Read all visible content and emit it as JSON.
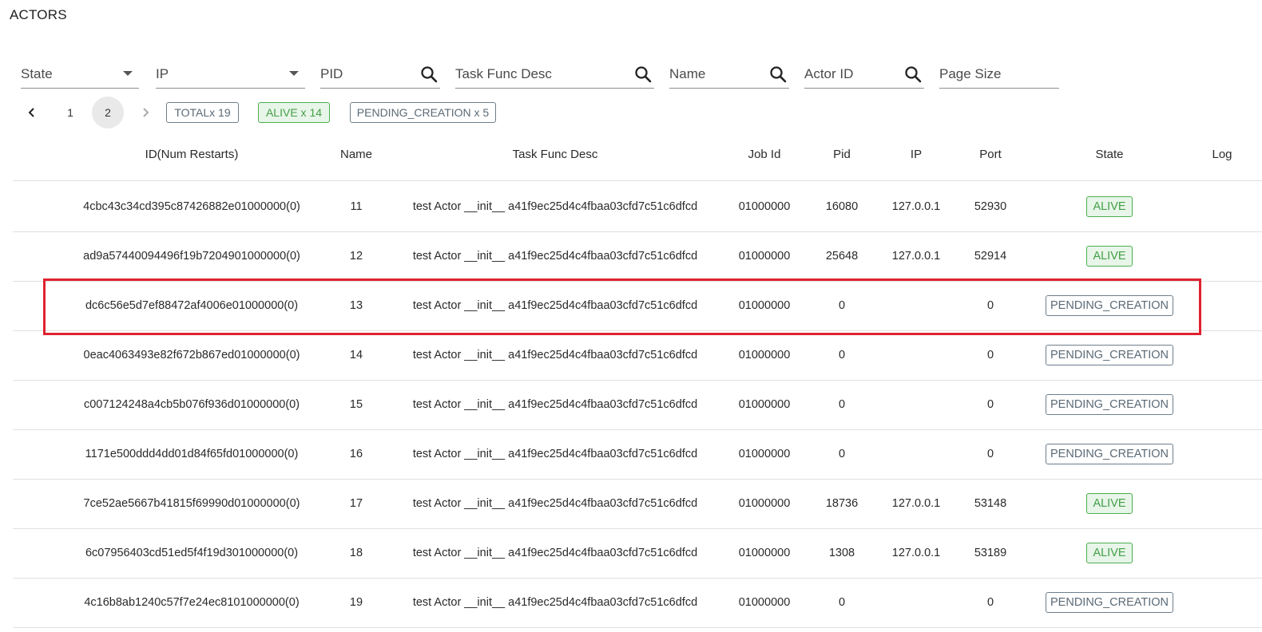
{
  "section_title": "ACTORS",
  "filters": {
    "state": "State",
    "ip": "IP",
    "pid": "PID",
    "task_func_desc": "Task Func Desc",
    "name": "Name",
    "actor_id": "Actor ID",
    "page_size": "Page Size"
  },
  "pagination": {
    "pages": [
      "1",
      "2"
    ],
    "current_page": "2",
    "prev_icon": "chevron-left-icon",
    "next_icon": "chevron-right-icon"
  },
  "summary": {
    "total": "TOTALx 19",
    "alive": "ALIVE x 14",
    "pending": "PENDING_CREATION x 5"
  },
  "columns": {
    "id": "ID(Num Restarts)",
    "name": "Name",
    "task": "Task Func Desc",
    "job": "Job Id",
    "pid": "Pid",
    "ip": "IP",
    "port": "Port",
    "state": "State",
    "log": "Log"
  },
  "rows": [
    {
      "id": "4cbc43c34cd395c87426882e01000000(0)",
      "name": "11",
      "task": "test Actor __init__ a41f9ec25d4c4fbaa03cfd7c51c6dfcd",
      "job": "01000000",
      "pid": "16080",
      "ip": "127.0.0.1",
      "port": "52930",
      "state": "ALIVE"
    },
    {
      "id": "ad9a57440094496f19b7204901000000(0)",
      "name": "12",
      "task": "test Actor __init__ a41f9ec25d4c4fbaa03cfd7c51c6dfcd",
      "job": "01000000",
      "pid": "25648",
      "ip": "127.0.0.1",
      "port": "52914",
      "state": "ALIVE"
    },
    {
      "id": "dc6c56e5d7ef88472af4006e01000000(0)",
      "name": "13",
      "task": "test Actor __init__ a41f9ec25d4c4fbaa03cfd7c51c6dfcd",
      "job": "01000000",
      "pid": "0",
      "ip": "",
      "port": "0",
      "state": "PENDING_CREATION"
    },
    {
      "id": "0eac4063493e82f672b867ed01000000(0)",
      "name": "14",
      "task": "test Actor __init__ a41f9ec25d4c4fbaa03cfd7c51c6dfcd",
      "job": "01000000",
      "pid": "0",
      "ip": "",
      "port": "0",
      "state": "PENDING_CREATION"
    },
    {
      "id": "c007124248a4cb5b076f936d01000000(0)",
      "name": "15",
      "task": "test Actor __init__ a41f9ec25d4c4fbaa03cfd7c51c6dfcd",
      "job": "01000000",
      "pid": "0",
      "ip": "",
      "port": "0",
      "state": "PENDING_CREATION"
    },
    {
      "id": "1171e500ddd4dd01d84f65fd01000000(0)",
      "name": "16",
      "task": "test Actor __init__ a41f9ec25d4c4fbaa03cfd7c51c6dfcd",
      "job": "01000000",
      "pid": "0",
      "ip": "",
      "port": "0",
      "state": "PENDING_CREATION"
    },
    {
      "id": "7ce52ae5667b41815f69990d01000000(0)",
      "name": "17",
      "task": "test Actor __init__ a41f9ec25d4c4fbaa03cfd7c51c6dfcd",
      "job": "01000000",
      "pid": "18736",
      "ip": "127.0.0.1",
      "port": "53148",
      "state": "ALIVE"
    },
    {
      "id": "6c07956403cd51ed5f4f19d301000000(0)",
      "name": "18",
      "task": "test Actor __init__ a41f9ec25d4c4fbaa03cfd7c51c6dfcd",
      "job": "01000000",
      "pid": "1308",
      "ip": "127.0.0.1",
      "port": "53189",
      "state": "ALIVE"
    },
    {
      "id": "4c16b8ab1240c57f7e24ec8101000000(0)",
      "name": "19",
      "task": "test Actor __init__ a41f9ec25d4c4fbaa03cfd7c51c6dfcd",
      "job": "01000000",
      "pid": "0",
      "ip": "",
      "port": "0",
      "state": "PENDING_CREATION"
    }
  ],
  "colors": {
    "alive_green": "#43a047",
    "pending_gray": "#5b6a76",
    "highlight_red": "#e0222f"
  }
}
